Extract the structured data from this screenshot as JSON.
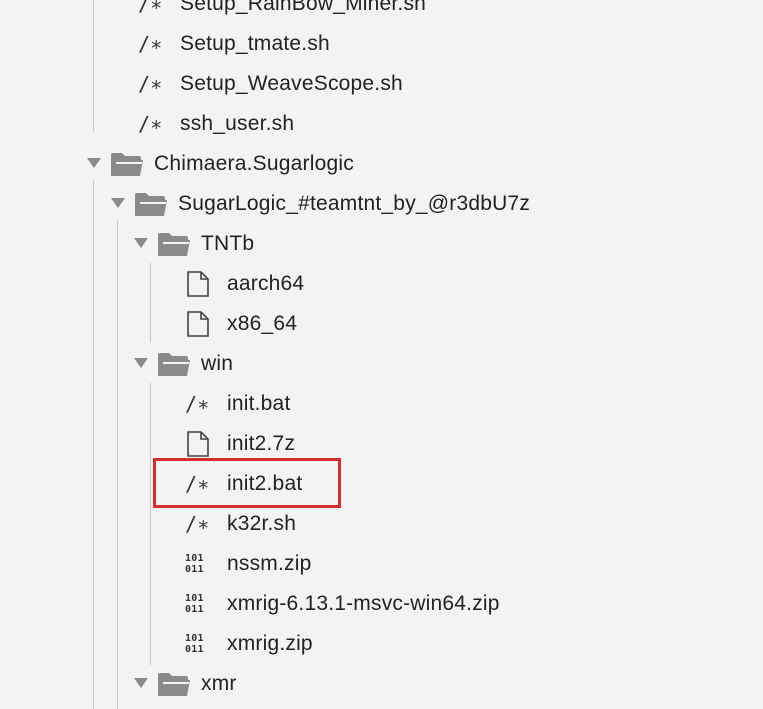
{
  "tree": {
    "items": [
      {
        "label": "Setup_RainBow_Miner.sh",
        "type": "script",
        "depth": 3
      },
      {
        "label": "Setup_tmate.sh",
        "type": "script",
        "depth": 3
      },
      {
        "label": "Setup_WeaveScope.sh",
        "type": "script",
        "depth": 3
      },
      {
        "label": "ssh_user.sh",
        "type": "script",
        "depth": 3
      },
      {
        "label": "Chimaera.Sugarlogic",
        "type": "folder",
        "depth": 0,
        "expanded": true
      },
      {
        "label": "SugarLogic_#teamtnt_by_@r3dbU7z",
        "type": "folder",
        "depth": 1,
        "expanded": true
      },
      {
        "label": "TNTb",
        "type": "folder",
        "depth": 2,
        "expanded": true
      },
      {
        "label": "aarch64",
        "type": "file",
        "depth": 3
      },
      {
        "label": "x86_64",
        "type": "file",
        "depth": 3
      },
      {
        "label": "win",
        "type": "folder",
        "depth": 2,
        "expanded": true
      },
      {
        "label": "init.bat",
        "type": "script",
        "depth": 3
      },
      {
        "label": "init2.7z",
        "type": "file",
        "depth": 3
      },
      {
        "label": "init2.bat",
        "type": "script",
        "depth": 3,
        "highlighted": true
      },
      {
        "label": "k32r.sh",
        "type": "script",
        "depth": 3
      },
      {
        "label": "nssm.zip",
        "type": "binary",
        "depth": 3
      },
      {
        "label": "xmrig-6.13.1-msvc-win64.zip",
        "type": "binary",
        "depth": 3
      },
      {
        "label": "xmrig.zip",
        "type": "binary",
        "depth": 3
      },
      {
        "label": "xmr",
        "type": "folder",
        "depth": 2,
        "expanded": true
      }
    ]
  },
  "glyphs": {
    "script": "/∗",
    "binary_top": "101",
    "binary_bottom": "011"
  },
  "colors": {
    "background": "#f3f3f3",
    "folder": "#8a8a8a",
    "chevron": "#8a8a8a",
    "highlight_border": "#d32f2f",
    "guide_line": "#c7c7c7"
  },
  "icons": {
    "folder": "folder-open-icon",
    "file": "file-icon",
    "script": "script-file-icon",
    "binary": "binary-file-icon",
    "chevron": "chevron-down-icon"
  }
}
